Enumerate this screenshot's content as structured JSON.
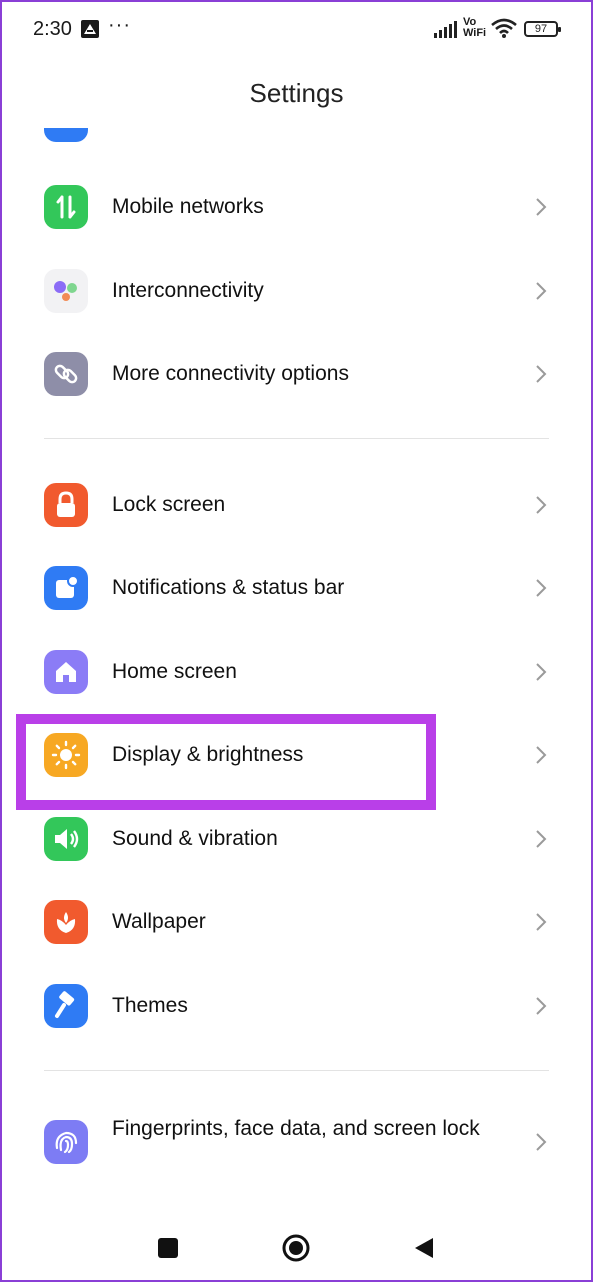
{
  "status_bar": {
    "time": "2:30",
    "more": "···",
    "vowifi_line1": "Vo",
    "vowifi_line2": "WiFi",
    "battery": "97"
  },
  "header": {
    "title": "Settings"
  },
  "groups": [
    {
      "items": [
        {
          "label": "Mobile networks",
          "icon": "mobile-data-icon",
          "color": "#33c75a"
        },
        {
          "label": "Interconnectivity",
          "icon": "interconnectivity-icon",
          "color": "#f2f2f4"
        },
        {
          "label": "More connectivity options",
          "icon": "link-icon",
          "color": "#8e8ea8"
        }
      ]
    },
    {
      "items": [
        {
          "label": "Lock screen",
          "icon": "lock-icon",
          "color": "#f15a2e"
        },
        {
          "label": "Notifications & status bar",
          "icon": "notification-icon",
          "color": "#2f7bf4"
        },
        {
          "label": "Home screen",
          "icon": "home-icon",
          "color": "#8b7cf6"
        },
        {
          "label": "Display & brightness",
          "icon": "sun-icon",
          "color": "#f7a823",
          "highlighted": true
        },
        {
          "label": "Sound & vibration",
          "icon": "speaker-icon",
          "color": "#33c75a"
        },
        {
          "label": "Wallpaper",
          "icon": "flower-icon",
          "color": "#f15a2e"
        },
        {
          "label": "Themes",
          "icon": "brush-icon",
          "color": "#2f7bf4"
        }
      ]
    },
    {
      "items": [
        {
          "label": "Fingerprints, face data, and screen lock",
          "icon": "fingerprint-icon",
          "color": "#7d7cf4"
        }
      ]
    }
  ],
  "nav_bar": {
    "recents": "square-icon",
    "home": "circle-icon",
    "back": "triangle-icon"
  }
}
